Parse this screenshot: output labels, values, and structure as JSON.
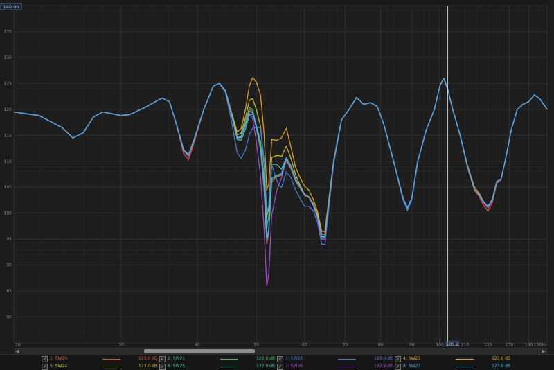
{
  "chart_data": {
    "type": "line",
    "xscale": "log",
    "xlim": [
      20,
      150
    ],
    "ylim": [
      75,
      140
    ],
    "grid": true,
    "y_ticks": [
      80,
      85,
      90,
      95,
      100,
      105,
      110,
      115,
      120,
      125,
      130,
      135
    ],
    "y_top_readout": "140.00",
    "x_tick_labels": [
      {
        "v": 20,
        "t": "20"
      },
      {
        "v": 30,
        "t": "30"
      },
      {
        "v": 40,
        "t": "40"
      },
      {
        "v": 50,
        "t": "50"
      },
      {
        "v": 60,
        "t": "60"
      },
      {
        "v": 70,
        "t": "70"
      },
      {
        "v": 80,
        "t": "80"
      },
      {
        "v": 90,
        "t": "90"
      },
      {
        "v": 100,
        "t": "100"
      },
      {
        "v": 110,
        "t": "110"
      },
      {
        "v": 120,
        "t": "120"
      },
      {
        "v": 130,
        "t": "130"
      },
      {
        "v": 140,
        "t": "140"
      },
      {
        "v": 150,
        "t": "150Hz"
      }
    ],
    "cursor": {
      "x": 103,
      "readout": "103.2"
    },
    "base_curve": [
      [
        20,
        119.5
      ],
      [
        22,
        118.8
      ],
      [
        24,
        116.5
      ],
      [
        25,
        114.5
      ],
      [
        26,
        115.5
      ],
      [
        27,
        118.5
      ],
      [
        28,
        119.5
      ],
      [
        30,
        118.8
      ],
      [
        31,
        119
      ],
      [
        33,
        120.5
      ],
      [
        35,
        122.2
      ],
      [
        36,
        121.5
      ],
      [
        37,
        117
      ],
      [
        38,
        112
      ],
      [
        38.7,
        111
      ],
      [
        39.5,
        114
      ],
      [
        41,
        120
      ],
      [
        42.5,
        124.5
      ],
      [
        43.5,
        125
      ],
      [
        44.5,
        123.5
      ],
      [
        45.5,
        119
      ],
      [
        46.5,
        114.5
      ],
      [
        47.2,
        114.5
      ],
      [
        48,
        117
      ],
      [
        48.7,
        119.5
      ],
      [
        49.3,
        119
      ],
      [
        50,
        116
      ],
      [
        50.8,
        112
      ],
      [
        51.5,
        104
      ],
      [
        52,
        94
      ],
      [
        52.4,
        96
      ],
      [
        53,
        106
      ],
      [
        54,
        107
      ],
      [
        55,
        107.5
      ],
      [
        56,
        110.5
      ],
      [
        57,
        109
      ],
      [
        58,
        106.5
      ],
      [
        59,
        105
      ],
      [
        60,
        103.5
      ],
      [
        61,
        103
      ],
      [
        62,
        101.5
      ],
      [
        63,
        99
      ],
      [
        64,
        95
      ],
      [
        64.8,
        95
      ],
      [
        65.5,
        100
      ],
      [
        67,
        110
      ],
      [
        69,
        118
      ],
      [
        71,
        120
      ],
      [
        73,
        122.3
      ],
      [
        75,
        121
      ],
      [
        77,
        121.3
      ],
      [
        79,
        120.5
      ],
      [
        81,
        117
      ],
      [
        84,
        110
      ],
      [
        87,
        103
      ],
      [
        88.5,
        101
      ],
      [
        90,
        103
      ],
      [
        92,
        110
      ],
      [
        95,
        116
      ],
      [
        98,
        120
      ],
      [
        100,
        124.5
      ],
      [
        101.5,
        126
      ],
      [
        103,
        124
      ],
      [
        105,
        120
      ],
      [
        108,
        115
      ],
      [
        111,
        109
      ],
      [
        114,
        104.5
      ],
      [
        116,
        103.5
      ],
      [
        118,
        102
      ],
      [
        120,
        101
      ],
      [
        122,
        102.5
      ],
      [
        124,
        106
      ],
      [
        126,
        106.5
      ],
      [
        128,
        110
      ],
      [
        131,
        116
      ],
      [
        134,
        120
      ],
      [
        137,
        121
      ],
      [
        140,
        121.5
      ],
      [
        143,
        122.8
      ],
      [
        146,
        122
      ],
      [
        150,
        120
      ]
    ],
    "series": [
      {
        "name": "1: SW20",
        "value": "123.0 dB",
        "color": "#e2503c",
        "perturb": [
          [
            38.7,
            -0.7
          ],
          [
            49,
            0.6
          ],
          [
            52,
            0
          ],
          [
            57,
            -0.5
          ],
          [
            64.5,
            0
          ],
          [
            120,
            -0.6
          ]
        ]
      },
      {
        "name": "2: SW21",
        "value": "122.9 dB",
        "color": "#52b86c",
        "perturb": [
          [
            38.7,
            0.3
          ],
          [
            49,
            0.9
          ],
          [
            52,
            0.5
          ],
          [
            57,
            -0.3
          ],
          [
            64.5,
            0.6
          ],
          [
            120,
            0.3
          ]
        ]
      },
      {
        "name": "3: SW22",
        "value": "123.0 dB",
        "color": "#4a7ed8",
        "perturb": [
          [
            46.8,
            -2
          ],
          [
            48.7,
            -4.5
          ],
          [
            50.6,
            1.5
          ],
          [
            52,
            6
          ],
          [
            54.5,
            -2.5
          ],
          [
            57,
            -1.5
          ],
          [
            60,
            -2
          ],
          [
            64.8,
            -1
          ],
          [
            88.5,
            -0.5
          ],
          [
            120,
            0.2
          ]
        ]
      },
      {
        "name": "4: SW23",
        "value": "123.0 dB",
        "color": "#e8a12a",
        "perturb": [
          [
            46.8,
            1
          ],
          [
            49.3,
            2.2
          ],
          [
            50,
            4
          ],
          [
            51.2,
            2
          ],
          [
            52,
            7
          ],
          [
            55,
            6
          ],
          [
            57,
            1.5
          ],
          [
            60,
            1.5
          ],
          [
            64.2,
            1.5
          ],
          [
            114,
            0.5
          ],
          [
            120,
            0
          ]
        ]
      },
      {
        "name": "5: SW24",
        "value": "123.0 dB",
        "color": "#c9c23a",
        "perturb": [
          [
            46.8,
            0.5
          ],
          [
            49.3,
            1.5
          ],
          [
            50.3,
            1.5
          ],
          [
            52,
            4
          ],
          [
            54.5,
            3
          ],
          [
            57,
            1
          ],
          [
            64.2,
            1
          ],
          [
            120,
            0.3
          ]
        ]
      },
      {
        "name": "6: SW25",
        "value": "122.9 dB",
        "color": "#48c9a8",
        "perturb": [
          [
            48.5,
            -1
          ],
          [
            50.3,
            1
          ],
          [
            52,
            0.5
          ],
          [
            53,
            3
          ],
          [
            57,
            0
          ],
          [
            64.5,
            0.3
          ],
          [
            120,
            0.2
          ]
        ]
      },
      {
        "name": "7: SW26",
        "value": "122.9 dB",
        "color": "#a84ed4",
        "perturb": [
          [
            51.8,
            0
          ],
          [
            52.1,
            -8
          ],
          [
            52.5,
            0
          ],
          [
            57,
            0
          ],
          [
            120,
            0
          ]
        ]
      },
      {
        "name": "8: SW27",
        "value": "123.0 dB",
        "color": "#4ab0e8",
        "perturb": [
          [
            38.7,
            0.2
          ],
          [
            49,
            0.2
          ],
          [
            52,
            1
          ],
          [
            57,
            0.2
          ],
          [
            64.5,
            0.5
          ],
          [
            120,
            0.2
          ]
        ]
      }
    ]
  },
  "legend_check": "✓"
}
